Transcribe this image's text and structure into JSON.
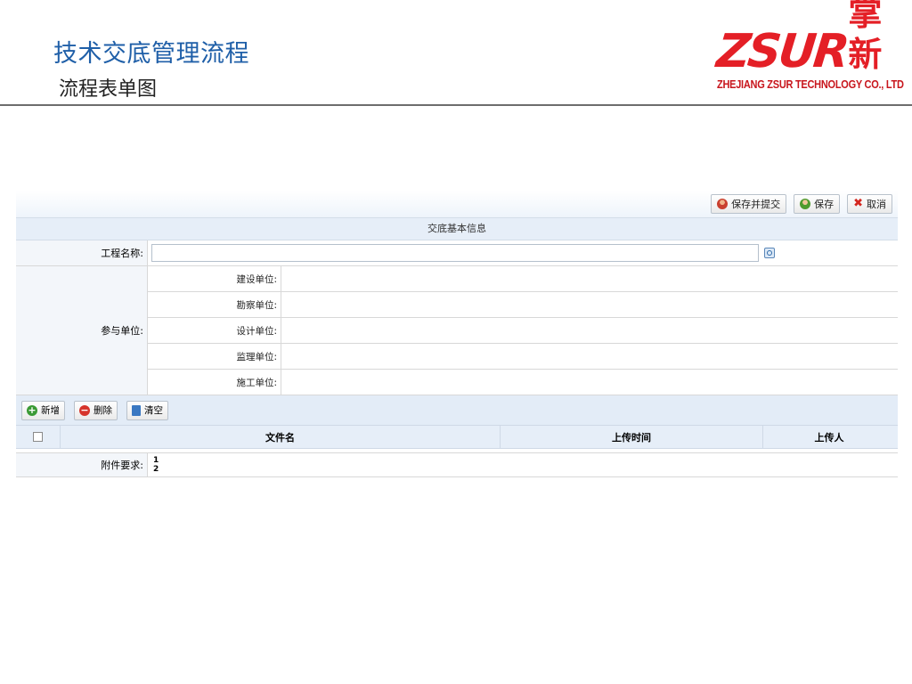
{
  "slide": {
    "title": "技术交底管理流程",
    "subtitle": "流程表单图"
  },
  "logo": {
    "latin": "ZSUR",
    "chinese": "掌新",
    "company": "ZHEJIANG ZSUR TECHNOLOGY CO., LTD",
    "color": "#e41f26"
  },
  "toolbar": {
    "save_submit_label": "保存并提交",
    "save_label": "保存",
    "cancel_label": "取消"
  },
  "section": {
    "title": "交底基本信息"
  },
  "fields": {
    "project_name_label": "工程名称:",
    "project_name_value": "",
    "participants_label": "参与单位:",
    "participants": [
      {
        "label": "建设单位:",
        "value": ""
      },
      {
        "label": "勘察单位:",
        "value": ""
      },
      {
        "label": "设计单位:",
        "value": ""
      },
      {
        "label": "监理单位:",
        "value": ""
      },
      {
        "label": "施工单位:",
        "value": ""
      }
    ]
  },
  "grid": {
    "add_label": "新增",
    "delete_label": "删除",
    "clear_label": "清空",
    "columns": [
      "文件名",
      "上传时间",
      "上传人"
    ]
  },
  "attachments": {
    "label": "附件要求:",
    "items": [
      "1",
      "2"
    ]
  },
  "colors": {
    "title_blue": "#1f5fa8",
    "header_bg": "#e6eef8"
  }
}
